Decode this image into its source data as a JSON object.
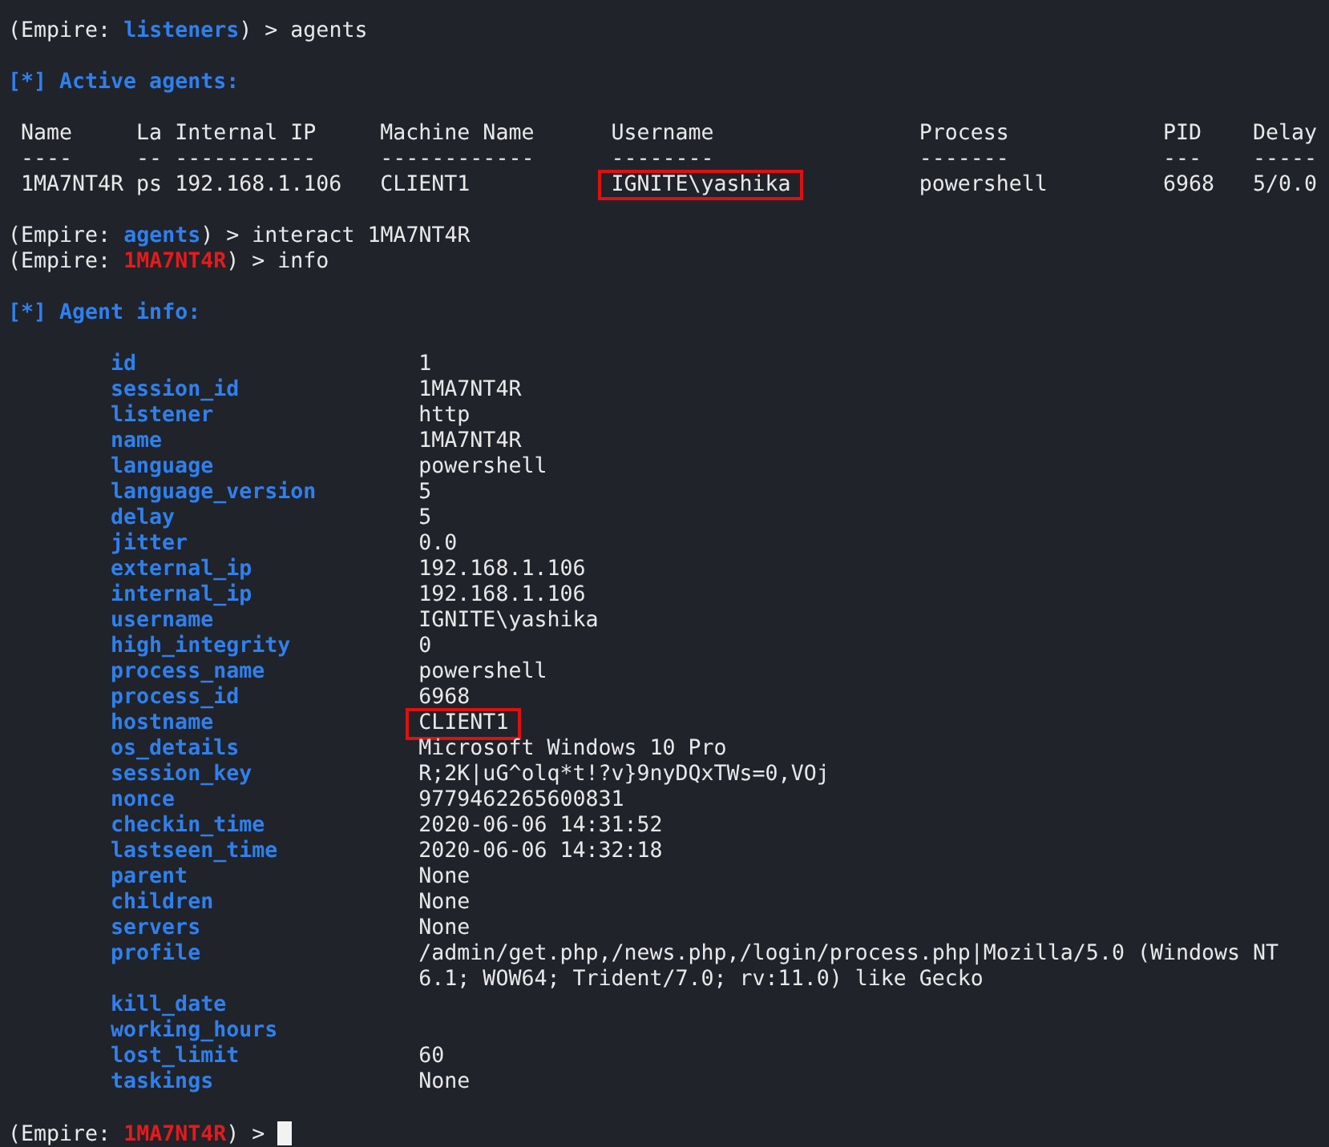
{
  "blocks": [
    {
      "lines": [
        {
          "kind": "prompt",
          "before": "(Empire:",
          "context": "listeners",
          "color": "#2f80ed",
          "after": ") >",
          "command": "agents",
          "cursor": false
        }
      ]
    },
    {
      "lines": [
        {
          "kind": "heading",
          "text": "[*] Active agents:"
        }
      ]
    },
    {
      "lines": [
        {
          "kind": "table",
          "columns": [
            {
              "label": "Name",
              "rule": "----"
            },
            {
              "label": "La",
              "rule": "--"
            },
            {
              "label": "Internal IP",
              "rule": "-----------"
            },
            {
              "label": "Machine Name",
              "rule": "------------"
            },
            {
              "label": "Username",
              "rule": "--------"
            },
            {
              "label": "Process",
              "rule": "-------"
            },
            {
              "label": "PID",
              "rule": "---"
            },
            {
              "label": "Delay",
              "rule": "-----"
            }
          ],
          "rows": [
            {
              "cells": [
                {
                  "text": "1MA7NT4R",
                  "highlighted": false
                },
                {
                  "text": "ps",
                  "highlighted": false
                },
                {
                  "text": "192.168.1.106",
                  "highlighted": false
                },
                {
                  "text": "CLIENT1",
                  "highlighted": false
                },
                {
                  "text": "IGNITE\\yashika",
                  "highlighted": true
                },
                {
                  "text": "powershell",
                  "highlighted": false
                },
                {
                  "text": "6968",
                  "highlighted": false
                },
                {
                  "text": "5/0.0",
                  "highlighted": false
                }
              ]
            }
          ]
        }
      ]
    },
    {
      "lines": [
        {
          "kind": "prompt",
          "before": "(Empire:",
          "context": "agents",
          "color": "#2f80ed",
          "after": ") >",
          "command": "interact 1MA7NT4R",
          "cursor": false
        },
        {
          "kind": "prompt",
          "before": "(Empire:",
          "context": "1MA7NT4R",
          "color": "#e41b1b",
          "after": ") >",
          "command": "info",
          "cursor": false
        }
      ]
    },
    {
      "lines": [
        {
          "kind": "heading",
          "text": "[*] Agent info:"
        }
      ]
    },
    {
      "lines": [
        {
          "kind": "info",
          "items": [
            {
              "key": "id",
              "value": "1",
              "highlighted": false
            },
            {
              "key": "session_id",
              "value": "1MA7NT4R",
              "highlighted": false
            },
            {
              "key": "listener",
              "value": "http",
              "highlighted": false
            },
            {
              "key": "name",
              "value": "1MA7NT4R",
              "highlighted": false
            },
            {
              "key": "language",
              "value": "powershell",
              "highlighted": false
            },
            {
              "key": "language_version",
              "value": "5",
              "highlighted": false
            },
            {
              "key": "delay",
              "value": "5",
              "highlighted": false
            },
            {
              "key": "jitter",
              "value": "0.0",
              "highlighted": false
            },
            {
              "key": "external_ip",
              "value": "192.168.1.106",
              "highlighted": false
            },
            {
              "key": "internal_ip",
              "value": "192.168.1.106",
              "highlighted": false
            },
            {
              "key": "username",
              "value": "IGNITE\\yashika",
              "highlighted": false
            },
            {
              "key": "high_integrity",
              "value": "0",
              "highlighted": false
            },
            {
              "key": "process_name",
              "value": "powershell",
              "highlighted": false
            },
            {
              "key": "process_id",
              "value": "6968",
              "highlighted": false
            },
            {
              "key": "hostname",
              "value": "CLIENT1",
              "highlighted": true
            },
            {
              "key": "os_details",
              "value": "Microsoft Windows 10 Pro",
              "highlighted": false
            },
            {
              "key": "session_key",
              "value": "R;2K|uG^olq*t!?v}9nyDQxTWs=0,VOj",
              "highlighted": false
            },
            {
              "key": "nonce",
              "value": "9779462265600831",
              "highlighted": false
            },
            {
              "key": "checkin_time",
              "value": "2020-06-06 14:31:52",
              "highlighted": false
            },
            {
              "key": "lastseen_time",
              "value": "2020-06-06 14:32:18",
              "highlighted": false
            },
            {
              "key": "parent",
              "value": "None",
              "highlighted": false
            },
            {
              "key": "children",
              "value": "None",
              "highlighted": false
            },
            {
              "key": "servers",
              "value": "None",
              "highlighted": false
            },
            {
              "key": "profile",
              "value": "/admin/get.php,/news.php,/login/process.php|Mozilla/5.0 (Windows NT 6.1; WOW64; Trident/7.0; rv:11.0) like Gecko",
              "highlighted": false
            },
            {
              "key": "kill_date",
              "highlighted": false
            },
            {
              "key": "working_hours",
              "highlighted": false
            },
            {
              "key": "lost_limit",
              "value": "60",
              "highlighted": false
            },
            {
              "key": "taskings",
              "value": "None",
              "highlighted": false
            }
          ]
        }
      ]
    },
    {
      "lines": [
        {
          "kind": "prompt",
          "before": "(Empire:",
          "context": "1MA7NT4R",
          "color": "#e41b1b",
          "after": ") >",
          "cursor": true
        }
      ]
    }
  ]
}
